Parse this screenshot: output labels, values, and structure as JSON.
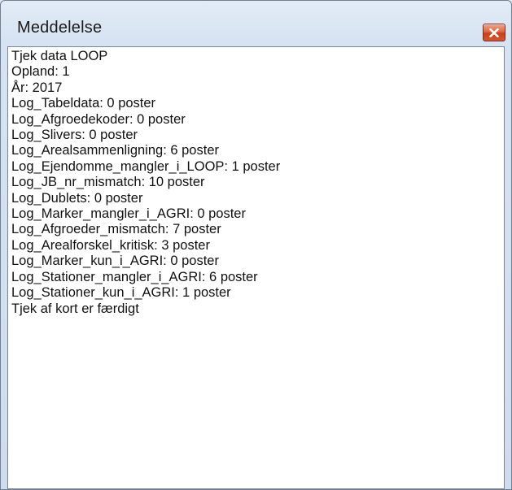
{
  "window": {
    "title": "Meddelelse",
    "close_icon": "close-x-icon"
  },
  "message": {
    "lines": [
      "Tjek data LOOP",
      "Opland: 1",
      "År: 2017",
      "Log_Tabeldata: 0 poster",
      "Log_Afgroedekoder: 0 poster",
      "Log_Slivers: 0 poster",
      "Log_Arealsammenligning: 6 poster",
      "Log_Ejendomme_mangler_i_LOOP: 1 poster",
      "Log_JB_nr_mismatch: 10 poster",
      "Log_Dublets: 0 poster",
      "Log_Marker_mangler_i_AGRI: 0 poster",
      "Log_Afgroeder_mismatch: 7 poster",
      "Log_Arealforskel_kritisk: 3 poster",
      "Log_Marker_kun_i_AGRI: 0 poster",
      "Log_Stationer_mangler_i_AGRI: 6 poster",
      "Log_Stationer_kun_i_AGRI: 1 poster",
      "Tjek af kort er færdigt"
    ]
  },
  "colors": {
    "close_button": "#d9552c",
    "text": "#111111",
    "frame": "#cfdcee"
  }
}
